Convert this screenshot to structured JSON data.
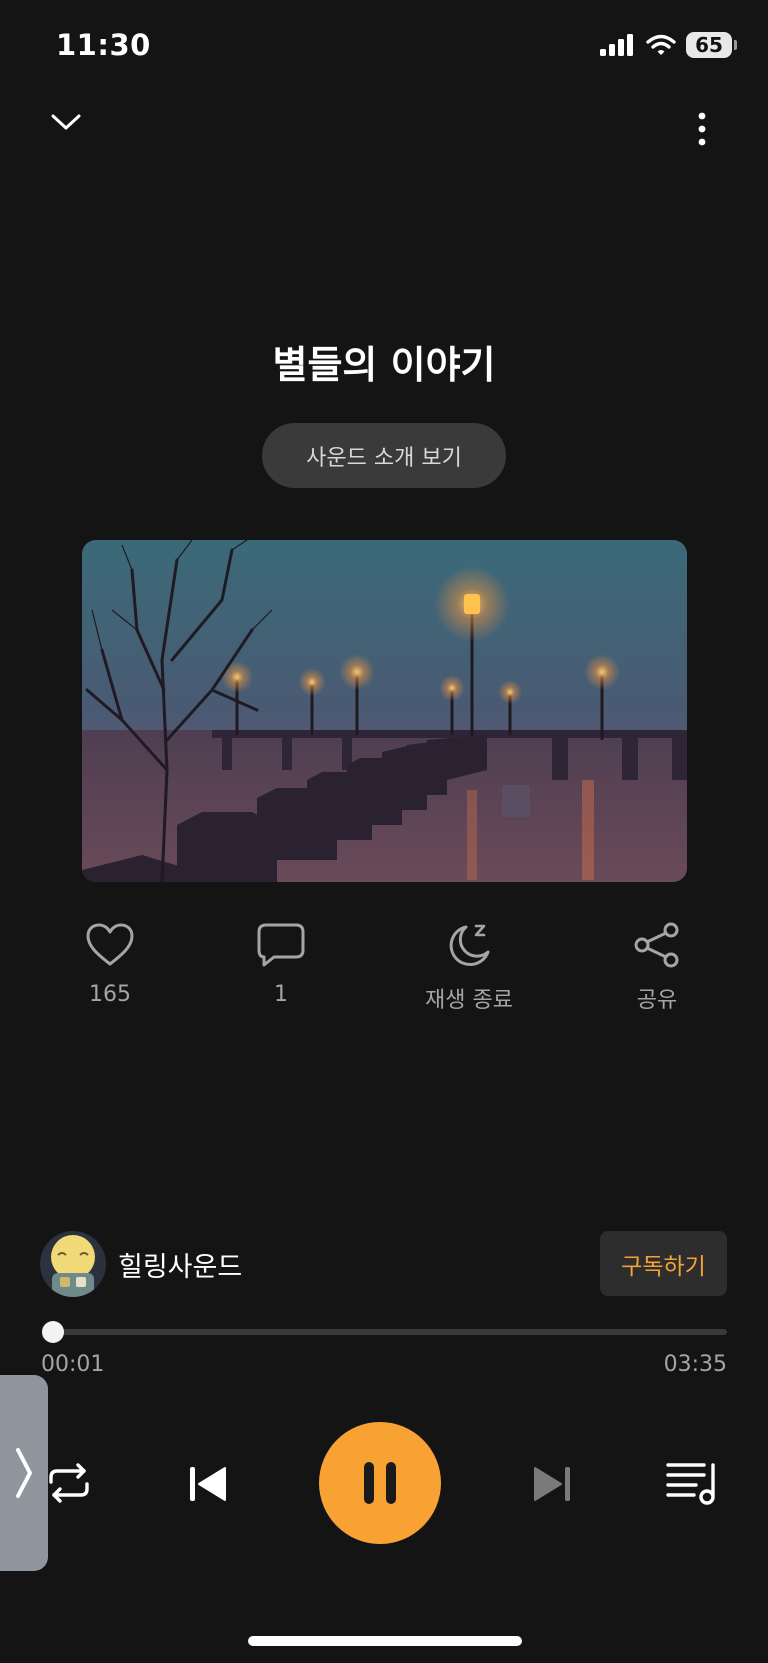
{
  "status_bar": {
    "time": "11:30",
    "battery": "65"
  },
  "track": {
    "title": "별들의 이야기",
    "intro_label": "사운드 소개 보기"
  },
  "actions": [
    {
      "key": "like",
      "label": "165"
    },
    {
      "key": "comment",
      "label": "1"
    },
    {
      "key": "sleep_timer",
      "label": "재생 종료"
    },
    {
      "key": "share",
      "label": "공유"
    }
  ],
  "channel": {
    "name": "힐링사운드",
    "subscribe_label": "구독하기"
  },
  "progress": {
    "current": "00:01",
    "total": "03:35",
    "fraction": 0.005
  },
  "player": {
    "state": "playing"
  },
  "colors": {
    "accent": "#f8a233",
    "background": "#141414",
    "subscribe_text": "#f5a13a"
  },
  "icons": {
    "collapse": "chevron-down-icon",
    "more": "more-vertical-icon",
    "like": "heart-icon",
    "comment": "speech-bubble-icon",
    "sleep_timer": "moon-zzz-icon",
    "share": "share-icon",
    "repeat": "repeat-icon",
    "previous": "skip-previous-icon",
    "pause": "pause-icon",
    "next": "skip-next-icon",
    "playlist": "playlist-music-icon",
    "side_handle": "chevron-right-icon"
  }
}
